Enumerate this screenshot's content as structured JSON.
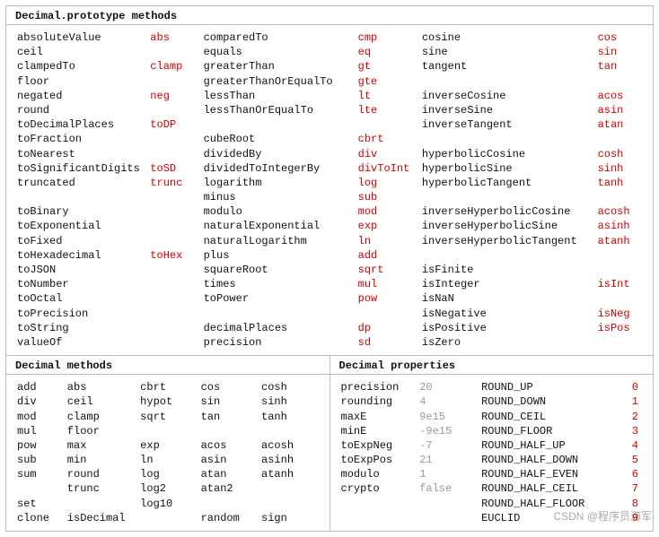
{
  "sections": {
    "proto_title": "Decimal.prototype methods",
    "methods_title": "Decimal methods",
    "props_title": "Decimal properties"
  },
  "proto": [
    [
      "absoluteValue",
      "abs",
      "comparedTo",
      "cmp",
      "cosine",
      "cos"
    ],
    [
      "ceil",
      "",
      "equals",
      "eq",
      "sine",
      "sin"
    ],
    [
      "clampedTo",
      "clamp",
      "greaterThan",
      "gt",
      "tangent",
      "tan"
    ],
    [
      "floor",
      "",
      "greaterThanOrEqualTo",
      "gte",
      "",
      ""
    ],
    [
      "negated",
      "neg",
      "lessThan",
      "lt",
      "inverseCosine",
      "acos"
    ],
    [
      "round",
      "",
      "lessThanOrEqualTo",
      "lte",
      "inverseSine",
      "asin"
    ],
    [
      "toDecimalPlaces",
      "toDP",
      "",
      "",
      "inverseTangent",
      "atan"
    ],
    [
      "toFraction",
      "",
      "cubeRoot",
      "cbrt",
      "",
      ""
    ],
    [
      "toNearest",
      "",
      "dividedBy",
      "div",
      "hyperbolicCosine",
      "cosh"
    ],
    [
      "toSignificantDigits",
      "toSD",
      "dividedToIntegerBy",
      "divToInt",
      "hyperbolicSine",
      "sinh"
    ],
    [
      "truncated",
      "trunc",
      "logarithm",
      "log",
      "hyperbolicTangent",
      "tanh"
    ],
    [
      "",
      "",
      "minus",
      "sub",
      "",
      ""
    ],
    [
      "toBinary",
      "",
      "modulo",
      "mod",
      "inverseHyperbolicCosine",
      "acosh"
    ],
    [
      "toExponential",
      "",
      "naturalExponential",
      "exp",
      "inverseHyperbolicSine",
      "asinh"
    ],
    [
      "toFixed",
      "",
      "naturalLogarithm",
      "ln",
      "inverseHyperbolicTangent",
      "atanh"
    ],
    [
      "toHexadecimal",
      "toHex",
      "plus",
      "add",
      "",
      ""
    ],
    [
      "toJSON",
      "",
      "squareRoot",
      "sqrt",
      "isFinite",
      ""
    ],
    [
      "toNumber",
      "",
      "times",
      "mul",
      "isInteger",
      "isInt"
    ],
    [
      "toOctal",
      "",
      "toPower",
      "pow",
      "isNaN",
      ""
    ],
    [
      "toPrecision",
      "",
      "",
      "",
      "isNegative",
      "isNeg"
    ],
    [
      "toString",
      "",
      "decimalPlaces",
      "dp",
      "isPositive",
      "isPos"
    ],
    [
      "valueOf",
      "",
      "precision",
      "sd",
      "isZero",
      ""
    ]
  ],
  "methods": [
    [
      "add",
      "abs",
      "cbrt",
      "cos",
      "cosh"
    ],
    [
      "div",
      "ceil",
      "hypot",
      "sin",
      "sinh"
    ],
    [
      "mod",
      "clamp",
      "sqrt",
      "tan",
      "tanh"
    ],
    [
      "mul",
      "floor",
      "",
      "",
      ""
    ],
    [
      "pow",
      "max",
      "exp",
      "acos",
      "acosh"
    ],
    [
      "sub",
      "min",
      "ln",
      "asin",
      "asinh"
    ],
    [
      "sum",
      "round",
      "log",
      "atan",
      "atanh"
    ],
    [
      "",
      "trunc",
      "log2",
      "atan2",
      ""
    ],
    [
      "set",
      "",
      "log10",
      "",
      ""
    ],
    [
      "clone",
      "isDecimal",
      "",
      "random",
      "sign"
    ]
  ],
  "props": [
    [
      "precision",
      "20",
      "ROUND_UP",
      "0"
    ],
    [
      "rounding",
      "4",
      "ROUND_DOWN",
      "1"
    ],
    [
      "maxE",
      "9e15",
      "ROUND_CEIL",
      "2"
    ],
    [
      "minE",
      "-9e15",
      "ROUND_FLOOR",
      "3"
    ],
    [
      "toExpNeg",
      "-7",
      "ROUND_HALF_UP",
      "4"
    ],
    [
      "toExpPos",
      "21",
      "ROUND_HALF_DOWN",
      "5"
    ],
    [
      "modulo",
      "1",
      "ROUND_HALF_EVEN",
      "6"
    ],
    [
      "crypto",
      "false",
      "ROUND_HALF_CEIL",
      "7"
    ],
    [
      "",
      "",
      "ROUND_HALF_FLOOR",
      "8"
    ],
    [
      "",
      "",
      "EUCLID",
      "9"
    ]
  ],
  "watermark": "CSDN @程序员海军"
}
